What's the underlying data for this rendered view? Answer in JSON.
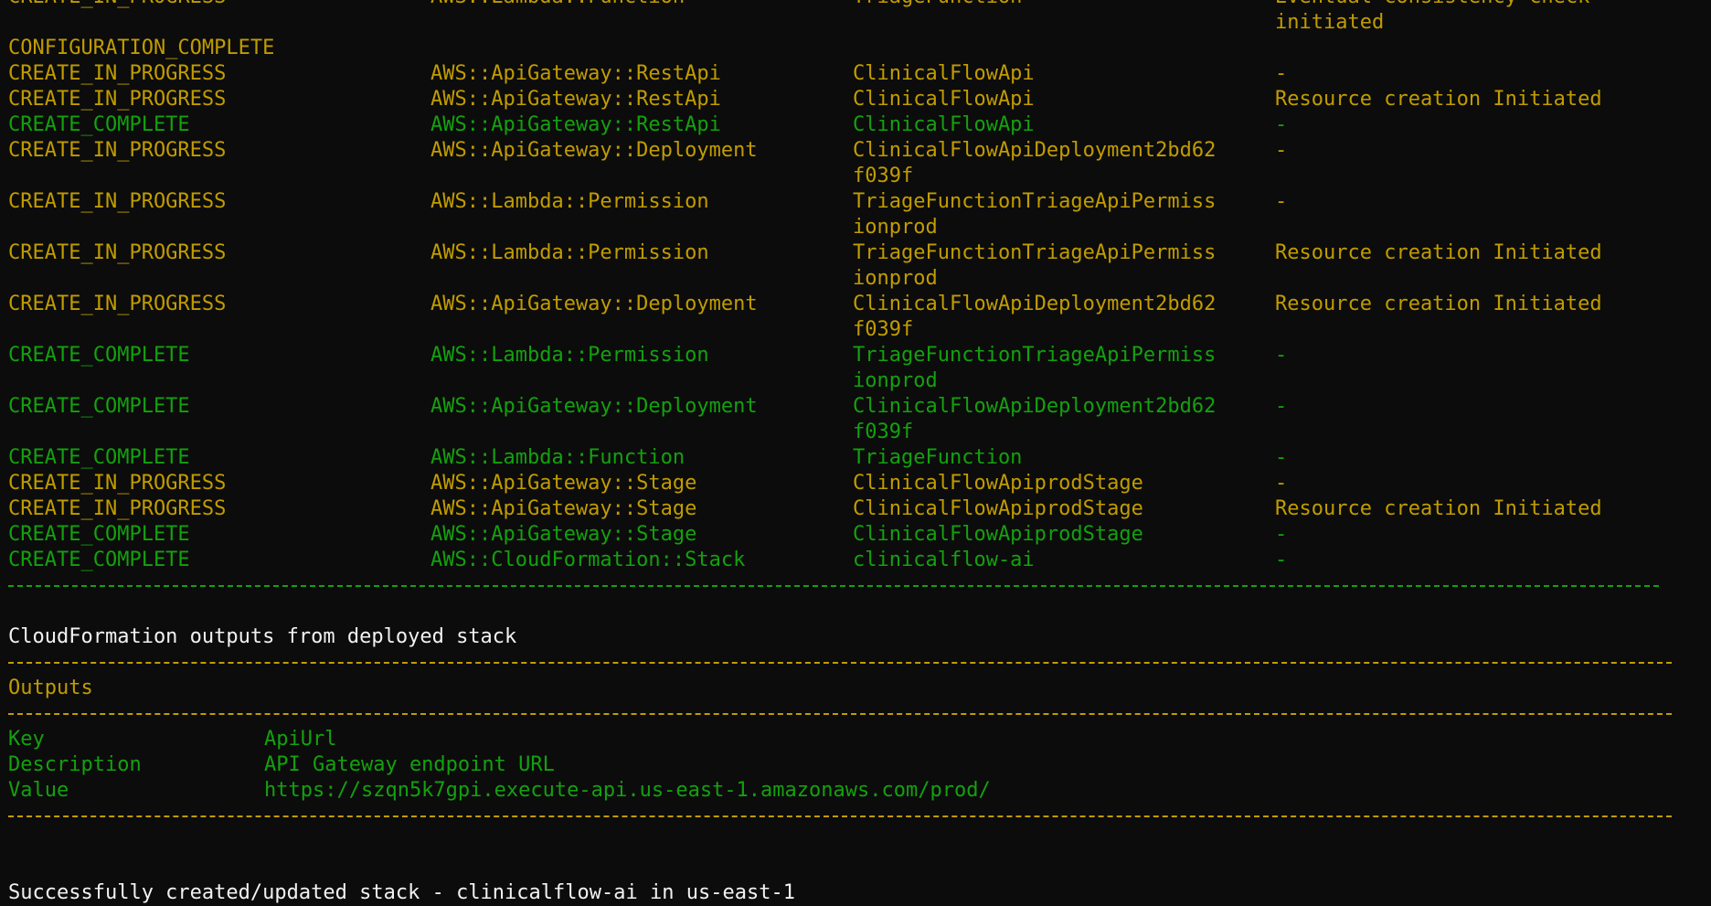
{
  "events": [
    {
      "status": "CREATE_IN_PROGRESS",
      "type": "AWS::Lambda::Function",
      "logical_id": [
        "TriageFunction"
      ],
      "reason": [
        "Eventual consistency check",
        "initiated"
      ],
      "color": "yellow"
    },
    {
      "status": "CONFIGURATION_COMPLETE",
      "type": "",
      "logical_id": [],
      "reason": [],
      "color": "yellow"
    },
    {
      "status": "CREATE_IN_PROGRESS",
      "type": "AWS::ApiGateway::RestApi",
      "logical_id": [
        "ClinicalFlowApi"
      ],
      "reason": [
        "-"
      ],
      "color": "yellow"
    },
    {
      "status": "CREATE_IN_PROGRESS",
      "type": "AWS::ApiGateway::RestApi",
      "logical_id": [
        "ClinicalFlowApi"
      ],
      "reason": [
        "Resource creation Initiated"
      ],
      "color": "yellow"
    },
    {
      "status": "CREATE_COMPLETE",
      "type": "AWS::ApiGateway::RestApi",
      "logical_id": [
        "ClinicalFlowApi"
      ],
      "reason": [
        "-"
      ],
      "color": "green"
    },
    {
      "status": "CREATE_IN_PROGRESS",
      "type": "AWS::ApiGateway::Deployment",
      "logical_id": [
        "ClinicalFlowApiDeployment2bd62",
        "f039f"
      ],
      "reason": [
        "-"
      ],
      "color": "yellow"
    },
    {
      "status": "CREATE_IN_PROGRESS",
      "type": "AWS::Lambda::Permission",
      "logical_id": [
        "TriageFunctionTriageApiPermiss",
        "ionprod"
      ],
      "reason": [
        "-"
      ],
      "color": "yellow"
    },
    {
      "status": "CREATE_IN_PROGRESS",
      "type": "AWS::Lambda::Permission",
      "logical_id": [
        "TriageFunctionTriageApiPermiss",
        "ionprod"
      ],
      "reason": [
        "Resource creation Initiated"
      ],
      "color": "yellow"
    },
    {
      "status": "CREATE_IN_PROGRESS",
      "type": "AWS::ApiGateway::Deployment",
      "logical_id": [
        "ClinicalFlowApiDeployment2bd62",
        "f039f"
      ],
      "reason": [
        "Resource creation Initiated"
      ],
      "color": "yellow"
    },
    {
      "status": "CREATE_COMPLETE",
      "type": "AWS::Lambda::Permission",
      "logical_id": [
        "TriageFunctionTriageApiPermiss",
        "ionprod"
      ],
      "reason": [
        "-"
      ],
      "color": "green"
    },
    {
      "status": "CREATE_COMPLETE",
      "type": "AWS::ApiGateway::Deployment",
      "logical_id": [
        "ClinicalFlowApiDeployment2bd62",
        "f039f"
      ],
      "reason": [
        "-"
      ],
      "color": "green"
    },
    {
      "status": "CREATE_COMPLETE",
      "type": "AWS::Lambda::Function",
      "logical_id": [
        "TriageFunction"
      ],
      "reason": [
        "-"
      ],
      "color": "green"
    },
    {
      "status": "CREATE_IN_PROGRESS",
      "type": "AWS::ApiGateway::Stage",
      "logical_id": [
        "ClinicalFlowApiprodStage"
      ],
      "reason": [
        "-"
      ],
      "color": "yellow"
    },
    {
      "status": "CREATE_IN_PROGRESS",
      "type": "AWS::ApiGateway::Stage",
      "logical_id": [
        "ClinicalFlowApiprodStage"
      ],
      "reason": [
        "Resource creation Initiated"
      ],
      "color": "yellow"
    },
    {
      "status": "CREATE_COMPLETE",
      "type": "AWS::ApiGateway::Stage",
      "logical_id": [
        "ClinicalFlowApiprodStage"
      ],
      "reason": [
        "-"
      ],
      "color": "green"
    },
    {
      "status": "CREATE_COMPLETE",
      "type": "AWS::CloudFormation::Stack",
      "logical_id": [
        "clinicalflow-ai"
      ],
      "reason": [
        "-"
      ],
      "color": "green"
    }
  ],
  "outputs_heading": "CloudFormation outputs from deployed stack",
  "outputs_title": "Outputs",
  "outputs": [
    {
      "label": "Key",
      "value": "ApiUrl"
    },
    {
      "label": "Description",
      "value": "API Gateway endpoint URL"
    },
    {
      "label": "Value",
      "value": "https://szqn5k7gpi.execute-api.us-east-1.amazonaws.com/prod/"
    }
  ],
  "success_message": "Successfully created/updated stack - clinicalflow-ai in us-east-1",
  "colors": {
    "background": "#0c0c0c",
    "yellow": "#c19c00",
    "green": "#13a10e",
    "white": "#f2f2f2"
  }
}
